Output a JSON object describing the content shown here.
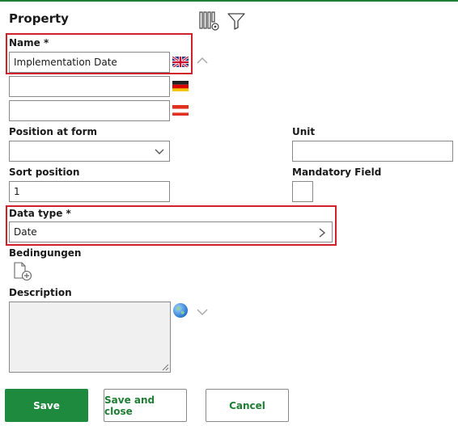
{
  "header": {
    "title": "Property"
  },
  "name": {
    "label": "Name *",
    "values": [
      "Implementation Date",
      "",
      ""
    ]
  },
  "position_at_form": {
    "label": "Position at form",
    "value": ""
  },
  "unit": {
    "label": "Unit",
    "value": ""
  },
  "sort_position": {
    "label": "Sort position",
    "value": "1"
  },
  "mandatory_field": {
    "label": "Mandatory Field",
    "checked": false
  },
  "data_type": {
    "label": "Data type *",
    "value": "Date"
  },
  "conditions": {
    "label": "Bedingungen"
  },
  "description": {
    "label": "Description",
    "value": ""
  },
  "buttons": {
    "save": "Save",
    "save_close": "Save and close",
    "cancel": "Cancel"
  },
  "icons": [
    "columns-settings-icon",
    "filter-icon",
    "uk-flag-icon",
    "germany-flag-icon",
    "austria-flag-icon",
    "chevron-up-icon",
    "chevron-down-icon",
    "chevron-right-icon",
    "add-document-icon",
    "globe-icon"
  ],
  "colors": {
    "accent_green": "#1e8a3e",
    "highlight_red": "#d0202a"
  }
}
